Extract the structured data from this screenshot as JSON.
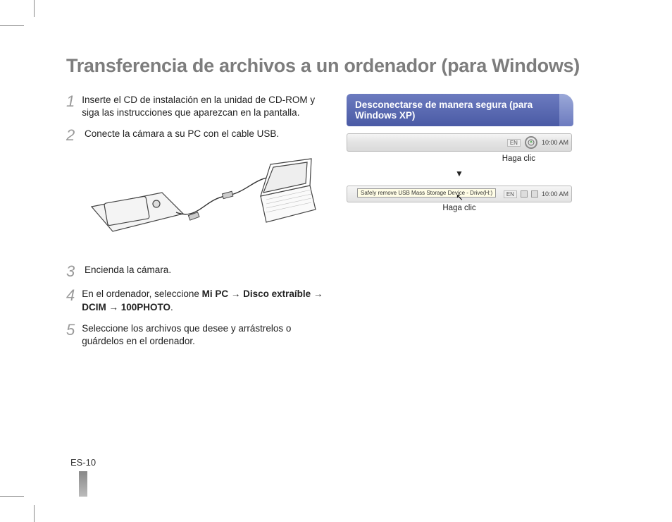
{
  "title": "Transferencia de archivos a un ordenador (para Windows)",
  "steps": {
    "s1": {
      "num": "1",
      "text": "Inserte el CD de instalación en la unidad de CD-ROM y siga las instrucciones que aparezcan en la pantalla."
    },
    "s2": {
      "num": "2",
      "text": "Conecte la cámara a su PC con el cable USB."
    },
    "s3": {
      "num": "3",
      "text": "Encienda la cámara."
    },
    "s4": {
      "num": "4",
      "prefix": "En el ordenador, seleccione ",
      "path": "Mi PC → Disco extraíble → DCIM → 100PHOTO",
      "suffix": "."
    },
    "s5": {
      "num": "5",
      "text": "Seleccione los archivos que desee y arrástrelos o guárdelos en el ordenador."
    }
  },
  "callout": {
    "title": "Desconectarse de manera segura (para Windows XP)",
    "click1": "Haga clic",
    "arrow": "▼",
    "tooltip": "Safely remove USB Mass Storage Device - Drive(H:)",
    "click2": "Haga clic",
    "tray_lang": "EN",
    "tray_time": "10:00 AM"
  },
  "page_number": "ES-10"
}
